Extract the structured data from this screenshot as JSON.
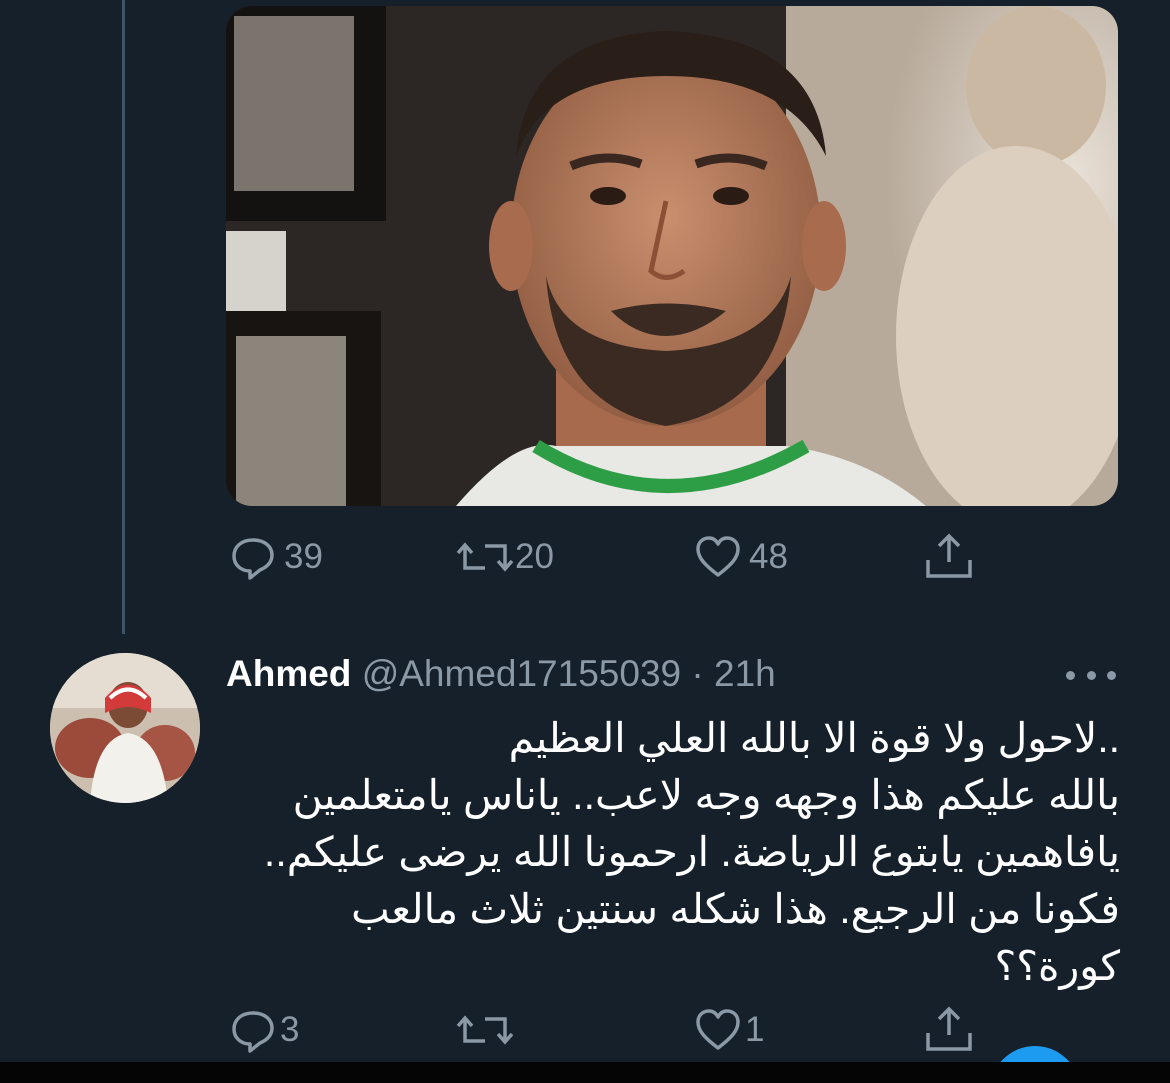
{
  "tweet_top": {
    "media_alt": "",
    "actions": {
      "replies": "39",
      "retweets": "20",
      "likes": "48"
    }
  },
  "reply": {
    "name": "Ahmed",
    "handle": "@Ahmed17155039",
    "separator": " · ",
    "time": "21h",
    "text_lines": [
      "..لاحول ولا قوة الا بالله العلي العظيم",
      "بالله عليكم هذا وجهه وجه لاعب.. ياناس يامتعلمين",
      "يافاهمين يابتوع الرياضة. ارحمونا الله يرضى عليكم..",
      "فكونا من الرجيع. هذا شكله سنتين ثلاث مالعب",
      "كورة؟؟"
    ],
    "actions": {
      "replies": "3",
      "retweets": "",
      "likes": "1"
    }
  },
  "icons": {
    "reply": "speech-bubble-icon",
    "retweet": "retweet-arrows-icon",
    "like": "heart-icon",
    "share": "share-upload-icon",
    "more": "more-dots-icon"
  },
  "colors": {
    "background": "#15202b",
    "muted": "#8b98a5",
    "text": "#ffffff",
    "accent": "#1d9bf0"
  }
}
